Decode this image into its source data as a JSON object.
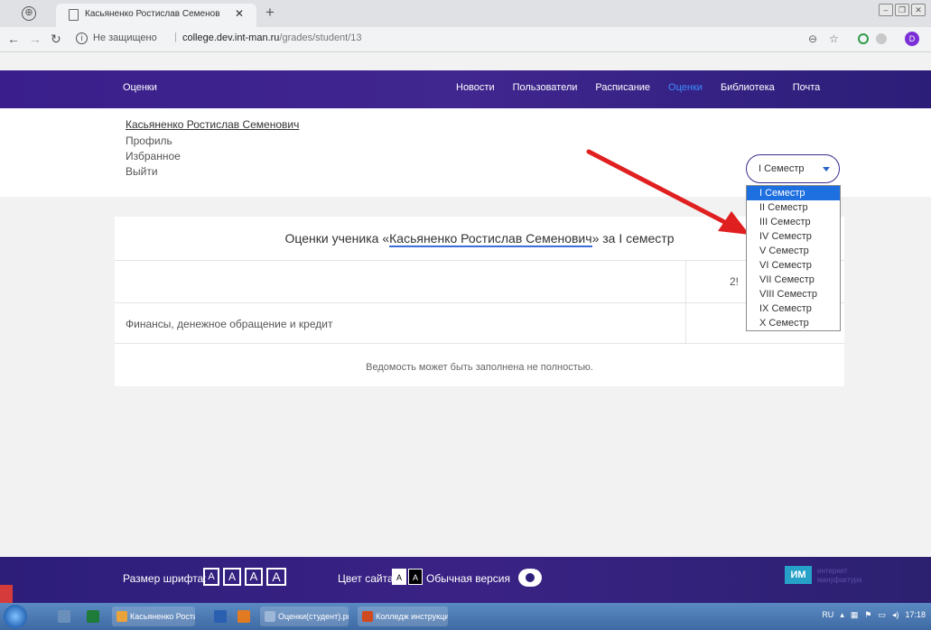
{
  "browser": {
    "tab_title": "Касьяненко Ростислав Семенов",
    "tab_close": "✕",
    "new_tab": "+",
    "insecure_label": "Не защищено",
    "url_host": "college.dev.int-man.ru",
    "url_path": "/grades/student/13",
    "avatar_letter": "D"
  },
  "header": {
    "logo": "Оценки",
    "nav": [
      "Новости",
      "Пользователи",
      "Расписание",
      "Оценки",
      "Библиотека",
      "Почта"
    ],
    "active_index": 3
  },
  "user": {
    "name": "Касьяненко Ростислав Семенович",
    "links": [
      "Профиль",
      "Избранное",
      "Выйти"
    ]
  },
  "semester": {
    "selected": "I Семестр",
    "options": [
      "I Семестр",
      "II Семестр",
      "III Семестр",
      "IV Семестр",
      "V Семестр",
      "VI Семестр",
      "VII Семестр",
      "VIII Семестр",
      "IX Семестр",
      "X Семестр"
    ],
    "selected_index": 0
  },
  "grades": {
    "title_prefix": "Оценки ученика «",
    "title_name": "Касьяненко Ростислав Семенович",
    "title_suffix": "» за I семестр",
    "date_partial": "2!",
    "subject": "Финансы, денежное обращение и кредит",
    "note": "Ведомость может быть заполнена не полностью."
  },
  "footer": {
    "font_label": "Размер шрифта:",
    "font_buttons": [
      "A",
      "A",
      "A",
      "A"
    ],
    "color_label": "Цвет сайта:",
    "color_buttons": [
      "A",
      "A"
    ],
    "normal_label": "Обычная версия",
    "brand_logo": "ИМ",
    "brand_line1": "интернет",
    "brand_line2": "мануфактура"
  },
  "taskbar": {
    "items": [
      "Касьяненко Ростис...",
      "Оценки(студент).pn...",
      "Колледж инструкци..."
    ],
    "tray_lang": "RU",
    "clock": "17:18"
  },
  "colors": {
    "header_bg": "#3a1f8c",
    "active_nav": "#3d8cff",
    "selected_option": "#1e6fe0",
    "arrow": "#e02020"
  }
}
